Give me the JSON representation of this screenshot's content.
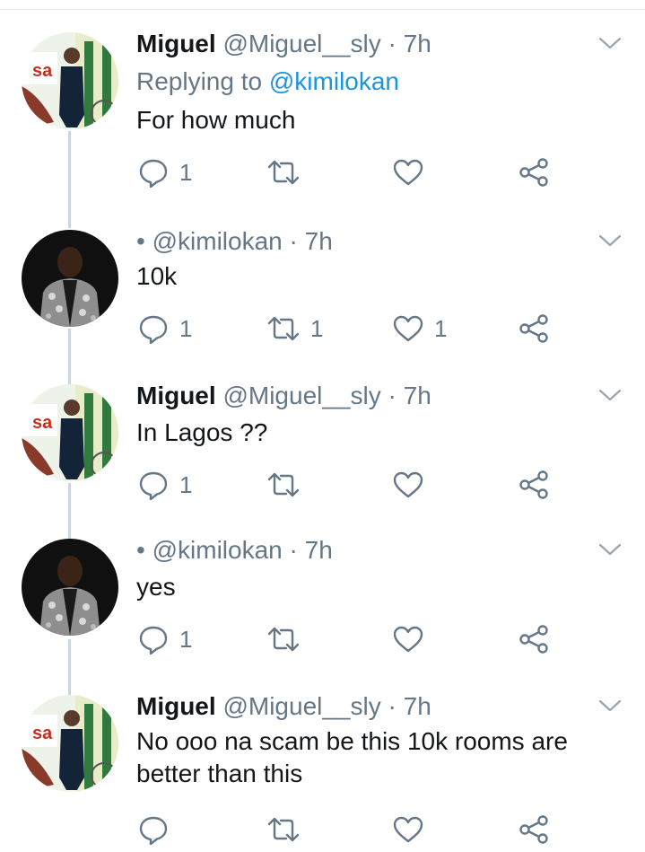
{
  "tweets": [
    {
      "name": "Miguel",
      "handle": "@Miguel__sly",
      "time": "7h",
      "bullet": "",
      "replying_prefix": "Replying to ",
      "replying_to": "@kimilokan",
      "text_lines": [
        "For how much"
      ],
      "avatar": "avatar-miguel",
      "counts": {
        "reply": "1",
        "retweet": "",
        "like": ""
      }
    },
    {
      "name": "",
      "handle": "@kimilokan",
      "time": "7h",
      "bullet": "•",
      "replying_prefix": "",
      "replying_to": "",
      "text_lines": [
        "10k"
      ],
      "avatar": "avatar-kimilokan",
      "counts": {
        "reply": "1",
        "retweet": "1",
        "like": "1"
      }
    },
    {
      "name": "Miguel",
      "handle": "@Miguel__sly",
      "time": "7h",
      "bullet": "",
      "replying_prefix": "",
      "replying_to": "",
      "text_lines": [
        "In Lagos ??"
      ],
      "avatar": "avatar-miguel",
      "counts": {
        "reply": "1",
        "retweet": "",
        "like": ""
      }
    },
    {
      "name": "",
      "handle": "@kimilokan",
      "time": "7h",
      "bullet": "•",
      "replying_prefix": "",
      "replying_to": "",
      "text_lines": [
        "yes"
      ],
      "avatar": "avatar-kimilokan",
      "counts": {
        "reply": "1",
        "retweet": "",
        "like": ""
      }
    },
    {
      "name": "Miguel",
      "handle": "@Miguel__sly",
      "time": "7h",
      "bullet": "",
      "replying_prefix": "",
      "replying_to": "",
      "text_lines": [
        "No ooo na scam be this 10k rooms are",
        "better than this"
      ],
      "avatar": "avatar-miguel",
      "counts": {
        "reply": "",
        "retweet": "",
        "like": ""
      }
    }
  ],
  "avatar_text": "sa",
  "colors": {
    "text": "#14171a",
    "secondary": "#657786",
    "link": "#1b95e0",
    "thread_line": "#ccd6dd",
    "icon": "#657786"
  },
  "icons": [
    "reply-icon",
    "retweet-icon",
    "like-icon",
    "share-icon",
    "chevron-down-icon"
  ]
}
